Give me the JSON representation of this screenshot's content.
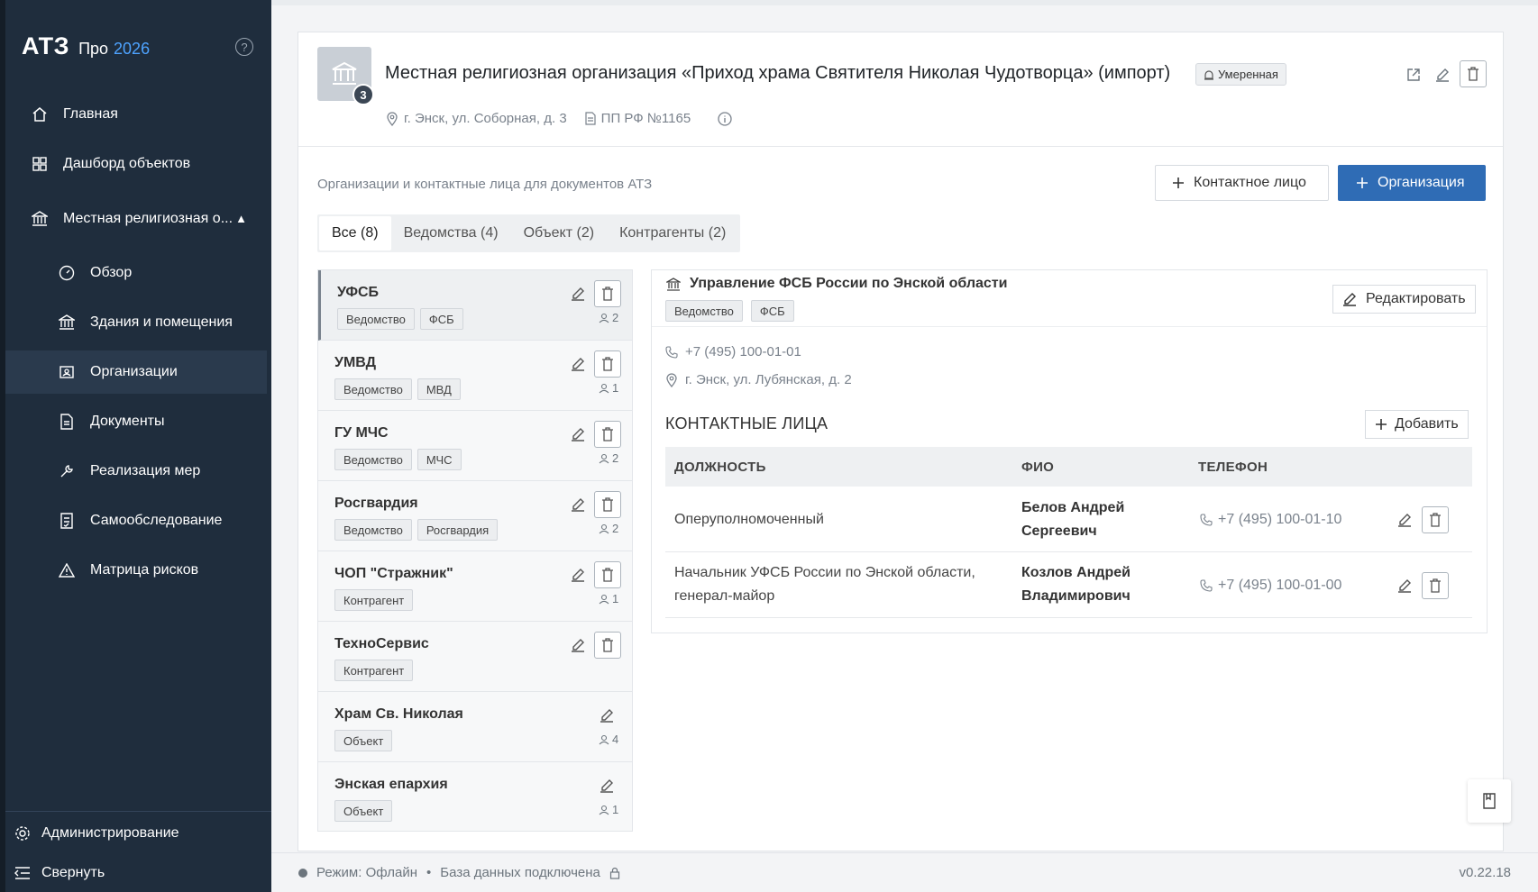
{
  "brand": {
    "main": "АТЗ",
    "pro": "Про",
    "year": "2026"
  },
  "sidebar": {
    "items": [
      {
        "label": "Главная",
        "icon": "home-icon"
      },
      {
        "label": "Дашборд объектов",
        "icon": "grid-icon"
      },
      {
        "label": "Местная религиозная о...",
        "icon": "building-icon"
      },
      {
        "label": "Обзор",
        "icon": "gauge-icon"
      },
      {
        "label": "Здания и помещения",
        "icon": "building-icon"
      },
      {
        "label": "Организации",
        "icon": "org-icon"
      },
      {
        "label": "Документы",
        "icon": "document-icon"
      },
      {
        "label": "Реализация мер",
        "icon": "tools-icon"
      },
      {
        "label": "Самообследование",
        "icon": "checklist-icon"
      },
      {
        "label": "Матрица рисков",
        "icon": "warning-icon"
      }
    ],
    "admin": "Администрирование",
    "collapse": "Свернуть"
  },
  "header": {
    "badge_count": "3",
    "title": "Местная религиозная организация «Приход храма Святителя Николая Чудотворца» (импорт)",
    "risk": "Умеренная",
    "address": "г. Энск, ул. Соборная, д. 3",
    "regulation": "ПП РФ №1165"
  },
  "section": {
    "caption": "Организации и контактные лица для документов АТЗ",
    "btn_contact": "Контактное лицо",
    "btn_org": "Организация"
  },
  "tabs": [
    {
      "label": "Все (8)"
    },
    {
      "label": "Ведомства (4)"
    },
    {
      "label": "Объект (2)"
    },
    {
      "label": "Контрагенты (2)"
    }
  ],
  "orgs": [
    {
      "name": "УФСБ",
      "tags": [
        "Ведомство",
        "ФСБ"
      ],
      "count": "2"
    },
    {
      "name": "УМВД",
      "tags": [
        "Ведомство",
        "МВД"
      ],
      "count": "1"
    },
    {
      "name": "ГУ МЧС",
      "tags": [
        "Ведомство",
        "МЧС"
      ],
      "count": "2"
    },
    {
      "name": "Росгвардия",
      "tags": [
        "Ведомство",
        "Росгвардия"
      ],
      "count": "2"
    },
    {
      "name": "ЧОП \"Стражник\"",
      "tags": [
        "Контрагент"
      ],
      "count": "1"
    },
    {
      "name": "ТехноСервис",
      "tags": [
        "Контрагент"
      ],
      "count": ""
    },
    {
      "name": "Храм Св. Николая",
      "tags": [
        "Объект"
      ],
      "count": "4"
    },
    {
      "name": "Энская епархия",
      "tags": [
        "Объект"
      ],
      "count": "1"
    }
  ],
  "detail": {
    "title": "Управление ФСБ России по Энской области",
    "tags": [
      "Ведомство",
      "ФСБ"
    ],
    "edit": "Редактировать",
    "phone": "+7 (495) 100-01-01",
    "address": "г. Энск, ул. Лубянская, д. 2",
    "contacts_heading": "КОНТАКТНЫЕ ЛИЦА",
    "add": "Добавить",
    "columns": [
      "ДОЛЖНОСТЬ",
      "ФИО",
      "ТЕЛЕФОН"
    ],
    "rows": [
      {
        "position_1": "Оперуполномоченный",
        "position_2": "",
        "fio_1": "Белов Андрей",
        "fio_2": "Сергеевич",
        "phone": "+7 (495) 100-01-10"
      },
      {
        "position_1": "Начальник УФСБ России по Энской области,",
        "position_2": "генерал-майор",
        "fio_1": "Козлов Андрей",
        "fio_2": "Владимирович",
        "phone": "+7 (495) 100-01-00"
      }
    ]
  },
  "footer": {
    "mode": "Режим: Офлайн",
    "db": "База данных подключена",
    "version": "v0.22.18"
  }
}
